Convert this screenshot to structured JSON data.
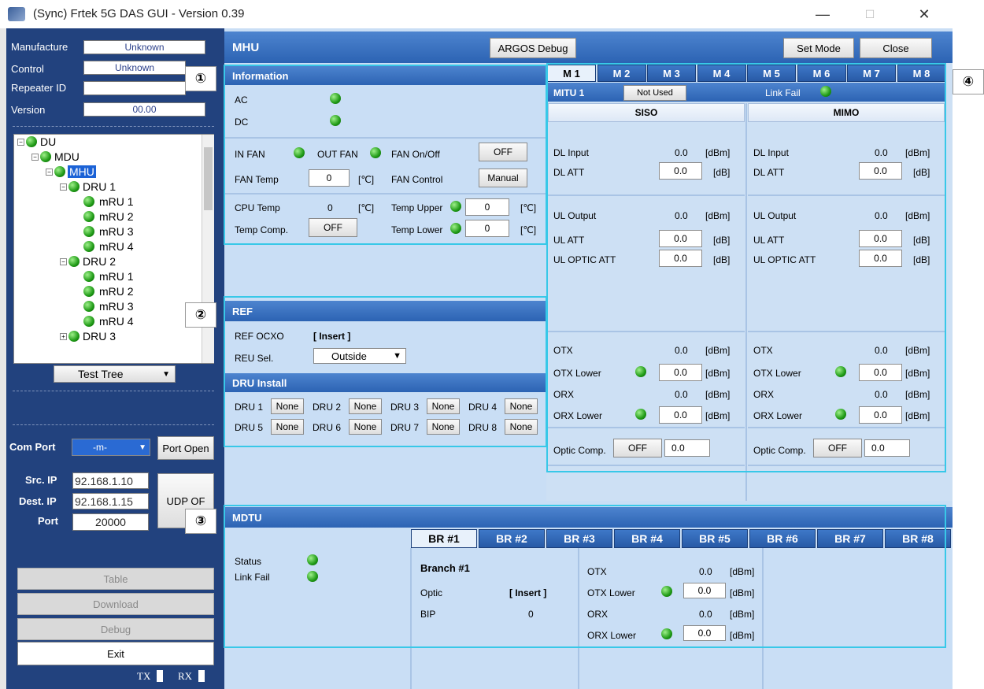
{
  "window": {
    "title": "(Sync) Frtek 5G DAS GUI - Version 0.39",
    "minimize": "—",
    "maximize": "☐",
    "close": "✕"
  },
  "left": {
    "manufacture_label": "Manufacture",
    "manufacture_value": "Unknown",
    "control_label": "Control",
    "control_value": "Unknown",
    "repeater_label": "Repeater ID",
    "repeater_value": "",
    "version_label": "Version",
    "version_value": "00.00",
    "tree": {
      "du": "DU",
      "mdu": "MDU",
      "mhu": "MHU",
      "dru1": "DRU 1",
      "dru2": "DRU 2",
      "dru3": "DRU 3",
      "mru": [
        "mRU 1",
        "mRU 2",
        "mRU 3",
        "mRU 4"
      ]
    },
    "tree_select": "Test Tree",
    "com_port_label": "Com Port",
    "com_port_value": "-m-",
    "port_open": "Port Open",
    "src_ip_label": "Src. IP",
    "src_ip": "92.168.1.10",
    "dest_ip_label": "Dest. IP",
    "dest_ip": "92.168.1.15",
    "port_label": "Port",
    "port_value": "20000",
    "udp_btn": "UDP OF",
    "table_btn": "Table",
    "download_btn": "Download",
    "debug_btn": "Debug",
    "exit_btn": "Exit",
    "tx": "TX",
    "rx": "RX"
  },
  "main": {
    "title": "MHU",
    "argos": "ARGOS Debug",
    "set_mode": "Set Mode",
    "close": "Close",
    "markers": [
      "①",
      "②",
      "③",
      "④"
    ]
  },
  "info": {
    "header": "Information",
    "ac": "AC",
    "dc": "DC",
    "in_fan": "IN FAN",
    "out_fan": "OUT FAN",
    "fan_onoff": "FAN On/Off",
    "fan_onoff_btn": "OFF",
    "fan_temp": "FAN Temp",
    "fan_temp_val": "0",
    "unit_c": "[℃]",
    "fan_control": "FAN Control",
    "fan_control_btn": "Manual",
    "cpu_temp": "CPU Temp",
    "cpu_temp_val": "0",
    "temp_upper": "Temp Upper",
    "temp_upper_val": "0",
    "temp_comp": "Temp Comp.",
    "temp_comp_btn": "OFF",
    "temp_lower": "Temp Lower",
    "temp_lower_val": "0"
  },
  "ref": {
    "header": "REF",
    "ocxo": "REF OCXO",
    "ocxo_val": "[ Insert ]",
    "reu_sel": "REU Sel.",
    "reu_val": "Outside",
    "dru_header": "DRU Install",
    "dru": [
      {
        "label": "DRU 1",
        "val": "None"
      },
      {
        "label": "DRU 2",
        "val": "None"
      },
      {
        "label": "DRU 3",
        "val": "None"
      },
      {
        "label": "DRU 4",
        "val": "None"
      },
      {
        "label": "DRU 5",
        "val": "None"
      },
      {
        "label": "DRU 6",
        "val": "None"
      },
      {
        "label": "DRU 7",
        "val": "None"
      },
      {
        "label": "DRU 8",
        "val": "None"
      }
    ]
  },
  "mitu": {
    "tabs": [
      "M 1",
      "M 2",
      "M 3",
      "M 4",
      "M 5",
      "M 6",
      "M 7",
      "M 8"
    ],
    "name": "MITU 1",
    "not_used": "Not Used",
    "link_fail": "Link Fail",
    "siso": "SISO",
    "mimo": "MIMO",
    "dl_input": "DL Input",
    "dl_att": "DL ATT",
    "ul_output": "UL Output",
    "ul_att": "UL ATT",
    "ul_optic_att": "UL OPTIC ATT",
    "otx": "OTX",
    "otx_lower": "OTX Lower",
    "orx": "ORX",
    "orx_lower": "ORX Lower",
    "optic_comp": "Optic Comp.",
    "optic_comp_btn": "OFF",
    "val": "0.0",
    "dbm": "[dBm]",
    "db": "[dB]"
  },
  "mdtu": {
    "header": "MDTU",
    "status": "Status",
    "link_fail": "Link Fail",
    "tabs": [
      "BR #1",
      "BR #2",
      "BR #3",
      "BR #4",
      "BR #5",
      "BR #6",
      "BR #7",
      "BR #8"
    ],
    "branch": "Branch #1",
    "optic": "Optic",
    "optic_val": "[ Insert ]",
    "bip": "BIP",
    "bip_val": "0",
    "otx": "OTX",
    "otx_lower": "OTX Lower",
    "orx": "ORX",
    "orx_lower": "ORX Lower",
    "val": "0.0",
    "dbm": "[dBm]"
  },
  "colors": {
    "panel_dark": "#22427e",
    "panel_light": "#c9def5",
    "highlight": "#38c8e8",
    "led": "#1f9a16"
  }
}
